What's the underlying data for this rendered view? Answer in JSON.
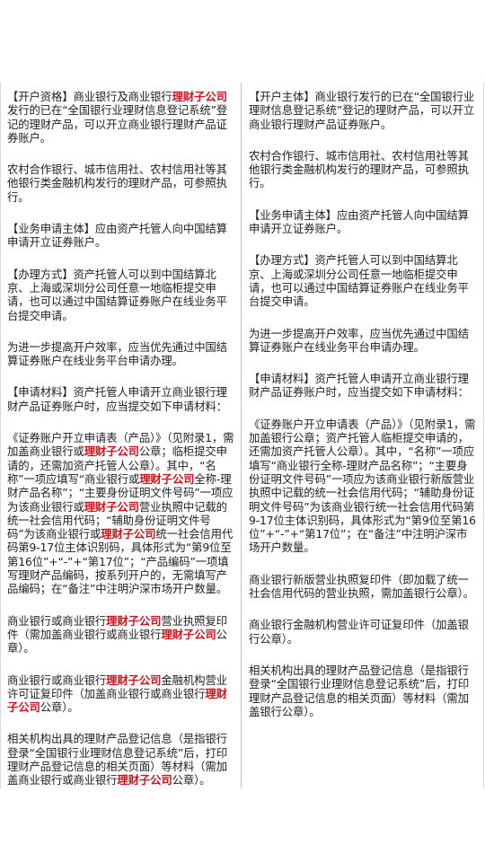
{
  "left_column": [
    {
      "segments": [
        {
          "t": "【开户资格】商业银行及商业银行"
        },
        {
          "t": "理财子公司",
          "hl": true
        },
        {
          "t": "发行的已在“全国银行业理财信息登记系统”登记的理财产品，可以开立商业银行理财产品证券账户。"
        }
      ]
    },
    {
      "segments": [
        {
          "t": "农村合作银行、城市信用社、农村信用社等其他银行类金融机构发行的理财产品，可参照执行。"
        }
      ]
    },
    {
      "segments": [
        {
          "t": "【业务申请主体】应由资产托管人向中国结算申请开立证券账户。"
        }
      ]
    },
    {
      "segments": [
        {
          "t": "【办理方式】资产托管人可以到中国结算北京、上海或深圳分公司任意一地临柜提交申请，也可以通过中国结算证券账户在线业务平台提交申请。"
        }
      ]
    },
    {
      "segments": [
        {
          "t": "为进一步提高开户效率，应当优先通过中国结算证券账户在线业务平台申请办理。"
        }
      ]
    },
    {
      "segments": [
        {
          "t": "【申请材料】资产托管人申请开立商业银行理财产品证券账户时，应当提交如下申请材料："
        }
      ]
    },
    {
      "segments": [
        {
          "t": "《证券账户开立申请表（产品）》（见附录1，需加盖商业银行或"
        },
        {
          "t": "理财子公司",
          "hl": true
        },
        {
          "t": "公章；临柜提交申请的，还需加资产托管人公章）。其中，“名称”一项应填写“商业银行或"
        },
        {
          "t": "理财子公司",
          "hl": true
        },
        {
          "t": "全称-理财产品名称”；“主要身份证明文件号码”一项应为该商业银行或"
        },
        {
          "t": "理财子公司",
          "hl": true
        },
        {
          "t": "营业执照中记载的统一社会信用代码；“辅助身份证明文件号码”为该商业银行或"
        },
        {
          "t": "理财子公司",
          "hl": true
        },
        {
          "t": "统一社会信用代码第9-17位主体识别码，具体形式为“第9位至第16位”+“-”+“第17位”；“产品编码”一项填写理财产品编码，按系列开户的，无需填写产品编码；在“备注”中注明沪深市场开户数量。"
        }
      ]
    },
    {
      "segments": [
        {
          "t": "商业银行或商业银行"
        },
        {
          "t": "理财子公司",
          "hl": true
        },
        {
          "t": "营业执照复印件（需加盖商业银行或商业银行"
        },
        {
          "t": "理财子公司",
          "hl": true
        },
        {
          "t": "公章）。"
        }
      ]
    },
    {
      "segments": [
        {
          "t": "商业银行或商业银行"
        },
        {
          "t": "理财子公司",
          "hl": true
        },
        {
          "t": "金融机构营业许可证复印件（加盖商业银行或商业银行"
        },
        {
          "t": "理财子公司",
          "hl": true
        },
        {
          "t": "公章）。"
        }
      ]
    },
    {
      "segments": [
        {
          "t": "相关机构出具的理财产品登记信息（是指银行登录“全国银行业理财信息登记系统”后，打印理财产品登记信息的相关页面）等材料（需加盖商业银行或商业银行"
        },
        {
          "t": "理财子公司",
          "hl": true
        },
        {
          "t": "公章）。"
        }
      ]
    }
  ],
  "right_column": [
    {
      "segments": [
        {
          "t": "【开户主体】商业银行发行的已在“全国银行业理财信息登记系统”登记的理财产品，可以开立商业银行理财产品证券账户。"
        }
      ]
    },
    {
      "segments": [
        {
          "t": "农村合作银行、城市信用社、农村信用社等其他银行类金融机构发行的理财产品，可参照执行。"
        }
      ]
    },
    {
      "segments": [
        {
          "t": "【业务申请主体】应由资产托管人向中国结算申请开立证券账户。"
        }
      ]
    },
    {
      "segments": [
        {
          "t": "【办理方式】资产托管人可以到中国结算北京、上海或深圳分公司任意一地临柜提交申请，也可以通过中国结算证券账户在线业务平台提交申请。"
        }
      ]
    },
    {
      "segments": [
        {
          "t": "为进一步提高开户效率，应当优先通过中国结算证券账户在线业务平台申请办理。"
        }
      ]
    },
    {
      "segments": [
        {
          "t": "【申请材料】资产托管人申请开立商业银行理财产品证券账户时，应当提交如下申请材料："
        }
      ]
    },
    {
      "segments": [
        {
          "t": "《证券账户开立申请表（产品）》（见附录1，需加盖银行公章；资产托管人临柜提交申请的，还需加资产托管人公章）。其中，“名称”一项应填写“商业银行全称-理财产品名称”；“主要身份证明文件号码”一项应为该商业银行新版营业执照中记载的统一社会信用代码；“辅助身份证明文件号码”为该商业银行统一社会信用代码第9-17位主体识别码，具体形式为“第9位至第16位”+“-”+“第17位”；在“备注”中注明沪深市场开户数量。"
        }
      ]
    },
    {
      "segments": [
        {
          "t": "商业银行新版营业执照复印件（即加载了统一社会信用代码的营业执照，需加盖银行公章）。"
        }
      ]
    },
    {
      "segments": [
        {
          "t": "商业银行金融机构营业许可证复印件（加盖银行公章）。"
        }
      ]
    },
    {
      "segments": [
        {
          "t": "相关机构出具的理财产品登记信息（是指银行登录“全国银行业理财信息登记系统”后，打印理财产品登记信息的相关页面）等材料（需加盖银行公章）。"
        }
      ]
    }
  ],
  "highlight_color": "#d0121b"
}
